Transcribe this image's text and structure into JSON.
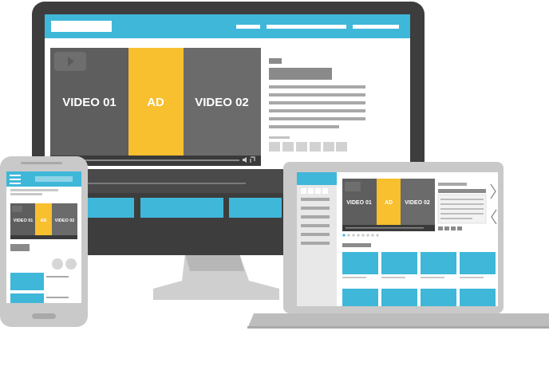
{
  "desktop": {
    "segments": [
      {
        "label": "VIDEO 01",
        "kind": "video"
      },
      {
        "label": "AD",
        "kind": "ad"
      },
      {
        "label": "VIDEO 02",
        "kind": "video"
      }
    ]
  },
  "laptop": {
    "segments": [
      {
        "label": "VIDEO 01",
        "kind": "video"
      },
      {
        "label": "AD",
        "kind": "ad"
      },
      {
        "label": "VIDEO 02",
        "kind": "video"
      }
    ]
  },
  "phone": {
    "segments": [
      {
        "label": "VIDEO 01",
        "kind": "video"
      },
      {
        "label": "AD",
        "kind": "ad"
      },
      {
        "label": "VIDEO 02",
        "kind": "video"
      }
    ]
  },
  "colors": {
    "accent": "#3fb7d9",
    "ad": "#f8bf2e",
    "video": "#6b6b6b",
    "frame": "#3d3d3d"
  },
  "icons": [
    "play-icon",
    "volume-icon",
    "fullscreen-icon",
    "hamburger-icon",
    "chevron-right-icon",
    "chevron-left-icon"
  ]
}
